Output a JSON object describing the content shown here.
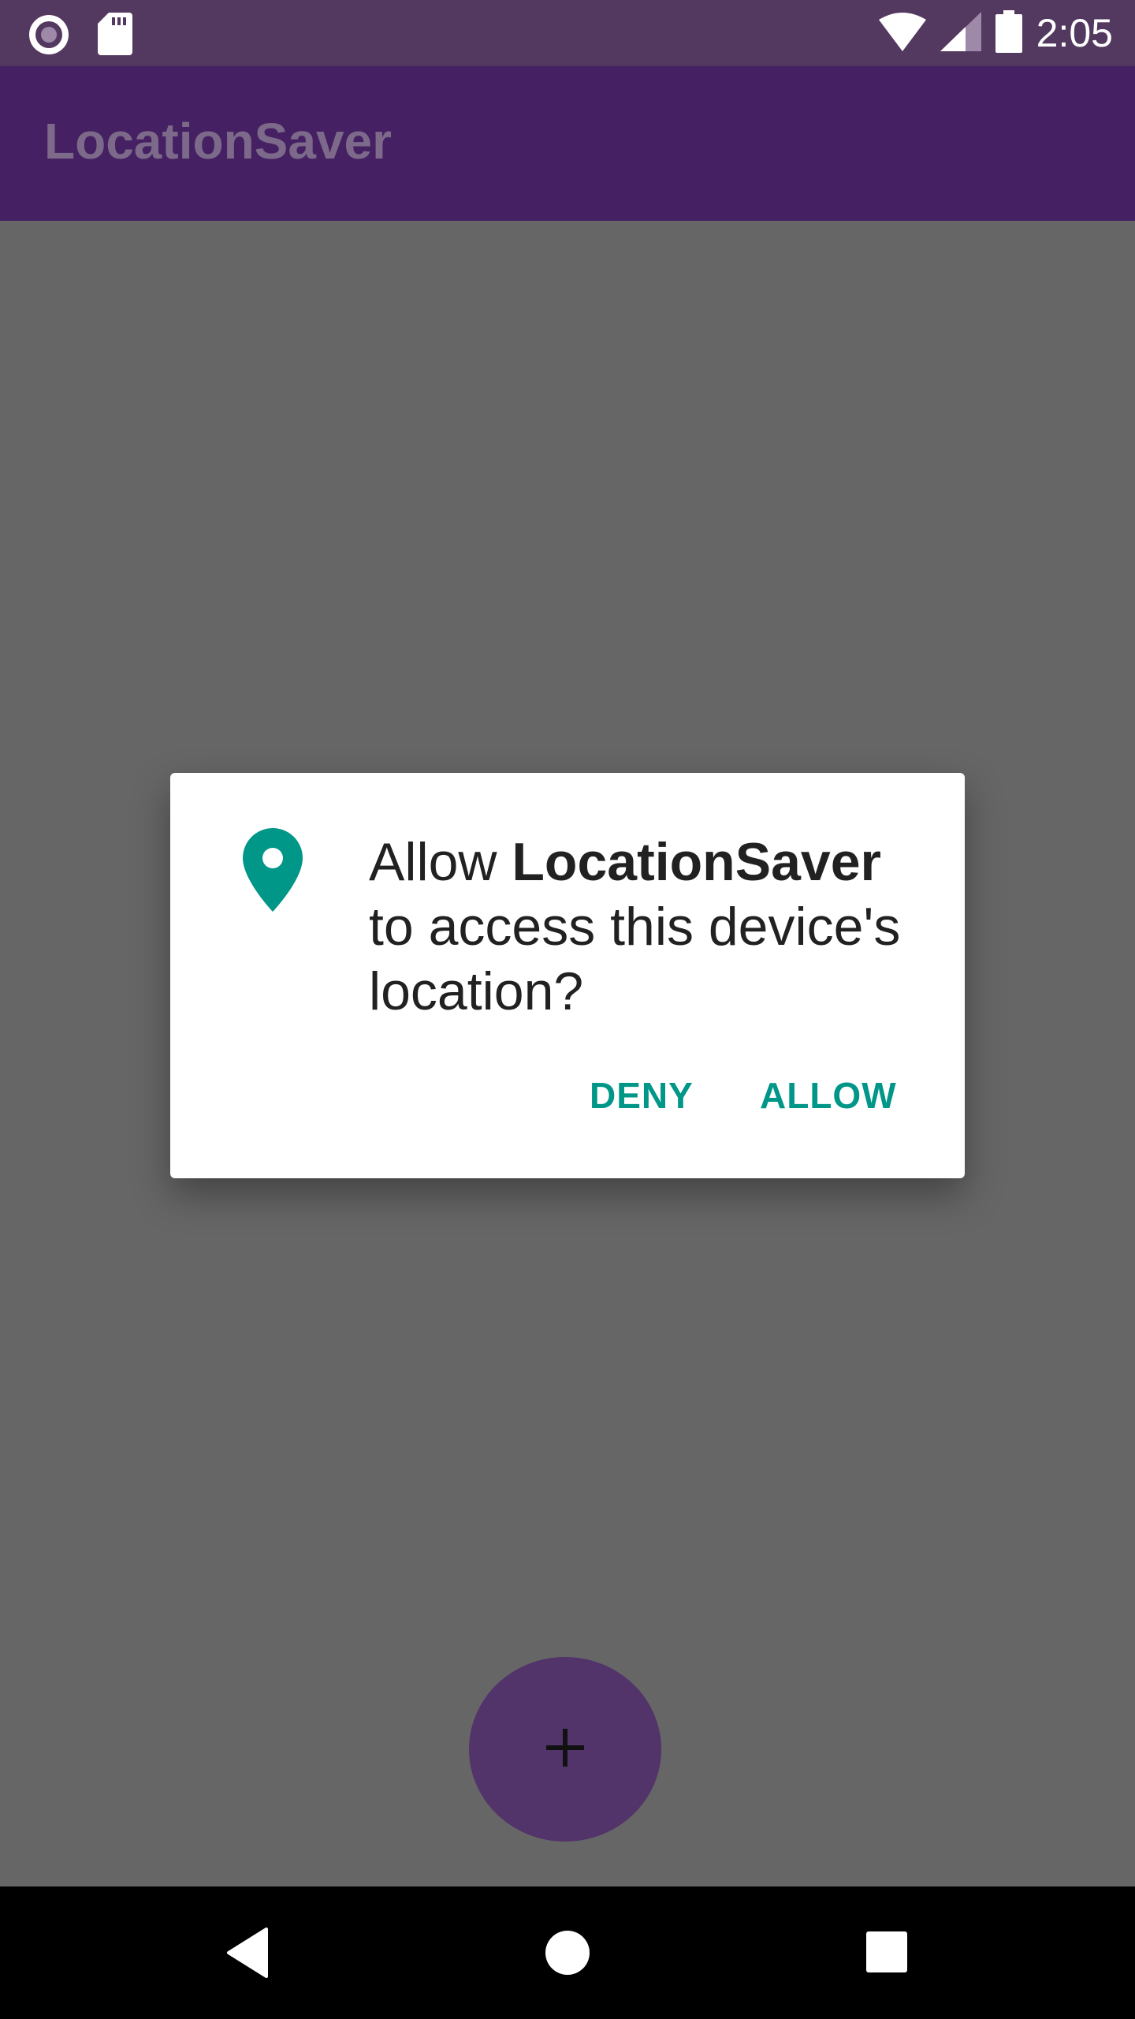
{
  "status_bar": {
    "time": "2:05",
    "icons": [
      "circle-notification-icon",
      "sd-card-icon",
      "wifi-icon",
      "cell-signal-icon",
      "battery-icon"
    ]
  },
  "app_bar": {
    "title": "LocationSaver"
  },
  "dialog": {
    "icon": "location-pin-icon",
    "message_prefix": "Allow ",
    "app_name": "LocationSaver",
    "message_suffix": "to access this device's location?",
    "deny_label": "DENY",
    "allow_label": "ALLOW"
  },
  "fab": {
    "icon": "plus-icon"
  },
  "nav_bar": {
    "icons": [
      "back-icon",
      "home-icon",
      "recents-icon"
    ]
  },
  "colors": {
    "status_bar": "#53385f",
    "app_bar": "#452163",
    "scrim_background": "#666666",
    "accent": "#009688",
    "fab": "#52336a"
  }
}
